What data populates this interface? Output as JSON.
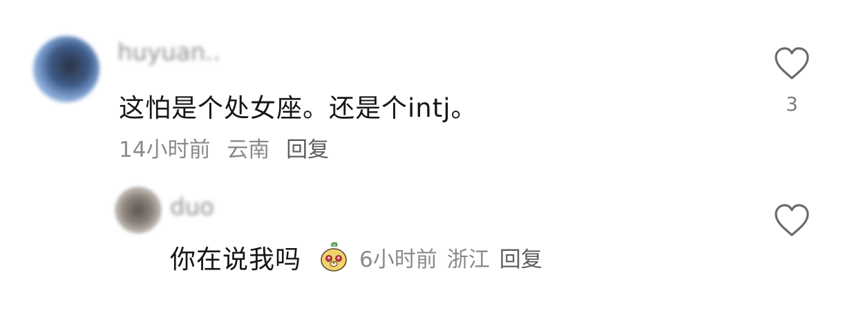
{
  "comments": [
    {
      "username": "huyuan..",
      "content": "这怕是个处女座。还是个intj。",
      "time": "14小时前",
      "location": "云南",
      "reply_label": "回复",
      "likes": "3",
      "like_icon": "heart-icon"
    }
  ],
  "replies": [
    {
      "username": "duo",
      "content": "你在说我吗",
      "emoji_icon": "smiling-creature-emoji-icon",
      "time": "6小时前",
      "location": "浙江",
      "reply_label": "回复",
      "like_icon": "heart-icon"
    }
  ],
  "colors": {
    "main_text": "#161616",
    "meta_text": "#8a8a8a",
    "icon_outline": "#6a6a6a"
  }
}
